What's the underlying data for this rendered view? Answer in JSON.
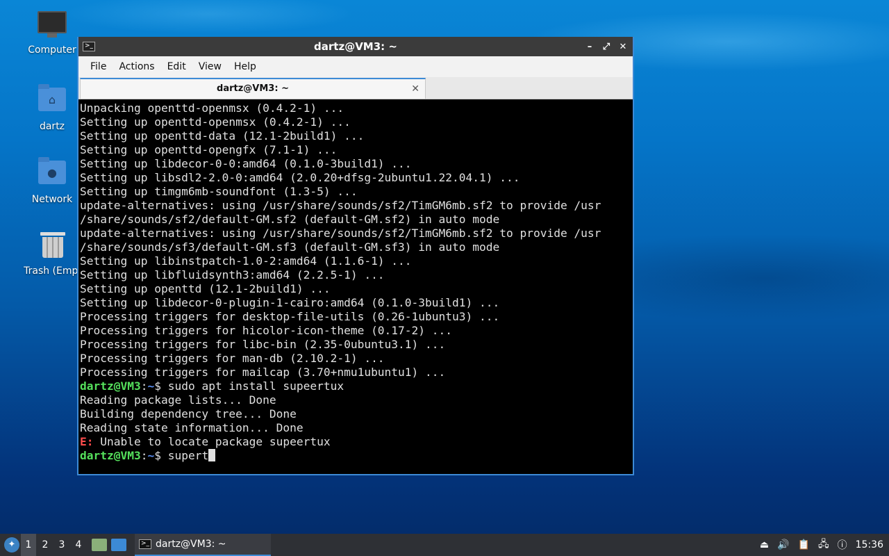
{
  "desktop": {
    "icons": [
      {
        "label": "Computer"
      },
      {
        "label": "dartz"
      },
      {
        "label": "Network"
      },
      {
        "label": "Trash (Empt"
      }
    ]
  },
  "window": {
    "title": "dartz@VM3: ~",
    "controls": {
      "minimize": "–",
      "maximize": "⤢",
      "close": "✕"
    },
    "menu": [
      "File",
      "Actions",
      "Edit",
      "View",
      "Help"
    ],
    "tab": {
      "label": "dartz@VM3: ~",
      "close": "✕"
    }
  },
  "terminal": {
    "lines": [
      "Unpacking openttd-openmsx (0.4.2-1) ...",
      "Setting up openttd-openmsx (0.4.2-1) ...",
      "Setting up openttd-data (12.1-2build1) ...",
      "Setting up openttd-opengfx (7.1-1) ...",
      "Setting up libdecor-0-0:amd64 (0.1.0-3build1) ...",
      "Setting up libsdl2-2.0-0:amd64 (2.0.20+dfsg-2ubuntu1.22.04.1) ...",
      "Setting up timgm6mb-soundfont (1.3-5) ...",
      "update-alternatives: using /usr/share/sounds/sf2/TimGM6mb.sf2 to provide /usr",
      "/share/sounds/sf2/default-GM.sf2 (default-GM.sf2) in auto mode",
      "update-alternatives: using /usr/share/sounds/sf2/TimGM6mb.sf2 to provide /usr",
      "/share/sounds/sf3/default-GM.sf3 (default-GM.sf3) in auto mode",
      "Setting up libinstpatch-1.0-2:amd64 (1.1.6-1) ...",
      "Setting up libfluidsynth3:amd64 (2.2.5-1) ...",
      "Setting up openttd (12.1-2build1) ...",
      "Setting up libdecor-0-plugin-1-cairo:amd64 (0.1.0-3build1) ...",
      "Processing triggers for desktop-file-utils (0.26-1ubuntu3) ...",
      "Processing triggers for hicolor-icon-theme (0.17-2) ...",
      "Processing triggers for libc-bin (2.35-0ubuntu3.1) ...",
      "Processing triggers for man-db (2.10.2-1) ...",
      "Processing triggers for mailcap (3.70+nmu1ubuntu1) ..."
    ],
    "prompt_user": "dartz@VM3",
    "prompt_sep": ":",
    "prompt_path": "~",
    "prompt_dollar": "$ ",
    "command1": "sudo apt install supeertux",
    "after_lines": [
      "Reading package lists... Done",
      "Building dependency tree... Done",
      "Reading state information... Done"
    ],
    "error_prefix": "E:",
    "error_text": " Unable to locate package supeertux",
    "current_input": "supert"
  },
  "taskbar": {
    "workspaces": [
      "1",
      "2",
      "3",
      "4"
    ],
    "active_workspace": "1",
    "task_label": "dartz@VM3: ~",
    "clock": "15:36",
    "colors": {
      "accent": "#3c8ad6",
      "panel": "#2e3035"
    }
  }
}
